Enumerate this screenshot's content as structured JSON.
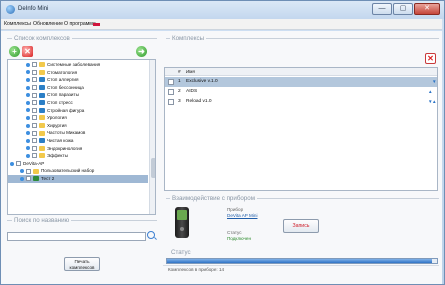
{
  "window": {
    "title": "DeInfo Mini",
    "min_glyph": "—",
    "max_glyph": "▢",
    "close_glyph": "✕"
  },
  "menu": [
    "Комплексы",
    "Обновление",
    "О программе"
  ],
  "left_panel": {
    "title": "Список комплексов",
    "add_glyph": "+",
    "remove_glyph": "✕",
    "move_glyph": "➜",
    "tree": [
      {
        "label": "Системные заболевания",
        "icon": "folder-icon"
      },
      {
        "label": "Стоматология",
        "icon": "folder-icon"
      },
      {
        "label": "Стоп аллергия",
        "icon": "book-icon"
      },
      {
        "label": "Стоп бессонница",
        "icon": "book-icon"
      },
      {
        "label": "Стоп паразиты",
        "icon": "book-icon"
      },
      {
        "label": "Стоп стресс",
        "icon": "book-icon"
      },
      {
        "label": "Стройная фигура",
        "icon": "book-icon"
      },
      {
        "label": "Урология",
        "icon": "folder-icon"
      },
      {
        "label": "Хирургия",
        "icon": "folder-icon"
      },
      {
        "label": "Частоты Микамов",
        "icon": "folder-icon"
      },
      {
        "label": "Чистая кожа",
        "icon": "book-icon"
      },
      {
        "label": "Эндокринология",
        "icon": "folder-icon"
      },
      {
        "label": "Эффекты",
        "icon": "folder-icon"
      },
      {
        "label": "DeVita-AP",
        "icon": "root-icon"
      },
      {
        "label": "Пользовательский набор",
        "icon": "folder-icon"
      },
      {
        "label": "Тест 2",
        "icon": "green-icon"
      }
    ],
    "search_title": "Поиск по названию",
    "search_value": "",
    "print_label_1": "Печать",
    "print_label_2": "комплексов"
  },
  "right_panel": {
    "title": "Комплексы",
    "delete_glyph": "✕",
    "columns": {
      "num": "#",
      "name": "Имя"
    },
    "rows": [
      {
        "num": "1",
        "name": "Exclusive v.1.0",
        "arrows": "▼"
      },
      {
        "num": "2",
        "name": "AIDS",
        "arrows": "▲ ▼"
      },
      {
        "num": "3",
        "name": "Reload v1.0",
        "arrows": "▲"
      }
    ],
    "interact_title": "Взаимодействие с прибором",
    "device_label": "Прибор",
    "device_name": "DeVita AP Mini",
    "status_label": "Статус",
    "status_value": "Подключен",
    "write_label": "Запись",
    "status_title": "Статус",
    "progress_fraction": 0.98,
    "footer_text": "Комплексов в приборе: 14"
  },
  "colors": {
    "accent": "#2f73c6",
    "brand_red": "#d0143b",
    "status_green": "#2a8a2a"
  }
}
